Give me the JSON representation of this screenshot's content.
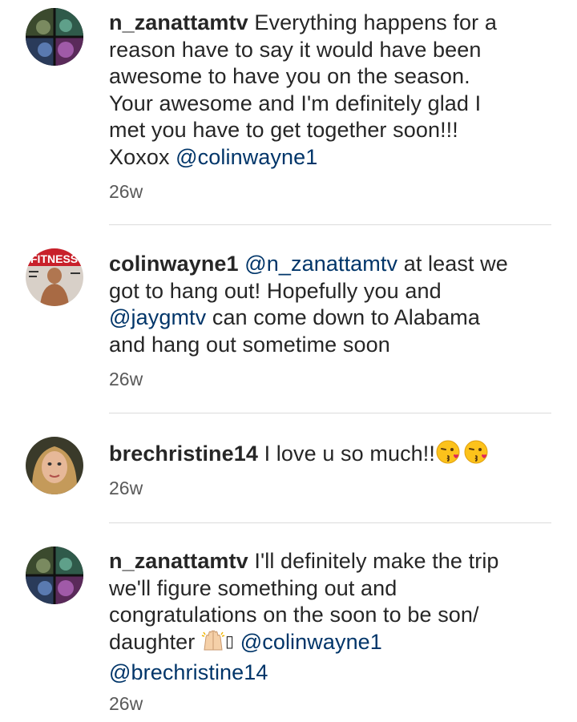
{
  "comments": [
    {
      "username": "n_zanattamtv",
      "text": "Everything happens for a reason have to say it would have been awesome to have you on the season. Your awesome and I'm definitely glad I met you have to get together soon!!! Xoxox",
      "mention": "@colinwayne1",
      "time": "26w",
      "avatar": "collage-avatar"
    },
    {
      "username": "colinwayne1",
      "mention_lead": "@n_zanattamtv",
      "text_a": "at least we got to hang out!  Hopefully you and",
      "mention_mid": "@jaygmtv",
      "text_b": "can come down to Alabama and hang out sometime soon",
      "time": "26w",
      "avatar": "magazine-cover-avatar"
    },
    {
      "username": "brechristine14",
      "text": "I love u so much!!",
      "emojis": [
        "kissing-heart-emoji",
        "kissing-heart-emoji"
      ],
      "time": "26w",
      "avatar": "portrait-avatar"
    },
    {
      "username": "n_zanattamtv",
      "text": "I'll definitely make the trip we'll figure something out and congratulations on the soon to be son/ daughter",
      "emojis": [
        "raising-hands-emoji",
        "missing-glyph"
      ],
      "missing_glyph": "▯",
      "mention_a": "@colinwayne1",
      "mention_b": "@brechristine14",
      "time": "26w",
      "avatar": "collage-avatar"
    }
  ],
  "colors": {
    "text": "#262626",
    "mention": "#003569",
    "timestamp": "#595959",
    "divider": "#dbdbdb"
  }
}
